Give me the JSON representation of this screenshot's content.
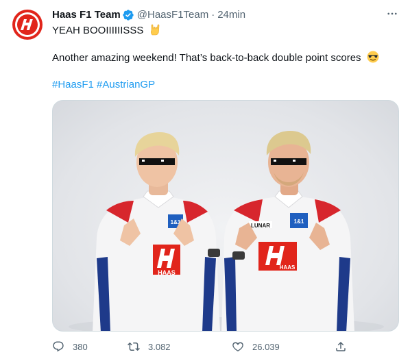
{
  "tweet": {
    "author": {
      "display_name": "Haas F1 Team",
      "handle": "@HaasF1Team",
      "verified": true,
      "avatar_logo": "haas-logo-icon"
    },
    "separator": "·",
    "time": "24min",
    "line1": "YEAH BOOIIIIIISSS",
    "line1_emoji": "sign-of-the-horns-emoji",
    "line2": "Another amazing weekend! That’s back-to-back double point scores",
    "line2_emoji": "smiling-face-with-sunglasses-emoji",
    "hashtags": [
      "#HaasF1",
      "#AustrianGP"
    ],
    "media": {
      "description_icon": "drivers-photo-image",
      "car_numbers_patch": "1&1",
      "sponsor_patch": "LUNAR"
    },
    "metrics": {
      "replies": "380",
      "retweets": "3.082",
      "likes": "26.039"
    }
  },
  "colors": {
    "text_primary": "#0f1419",
    "text_secondary": "#536471",
    "link": "#1d9bf0",
    "verified": "#1d9bf0",
    "border": "#cfd9de",
    "brand_red": "#e1251b"
  }
}
